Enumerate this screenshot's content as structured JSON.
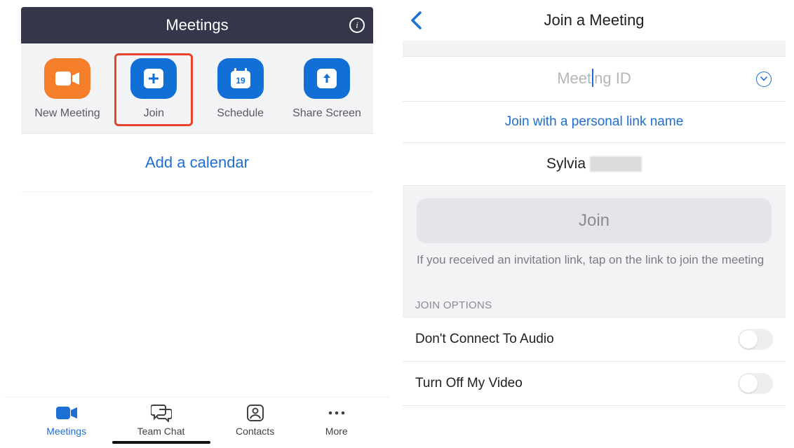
{
  "left": {
    "header_title": "Meetings",
    "actions": {
      "new_meeting": "New Meeting",
      "join": "Join",
      "schedule": "Schedule",
      "schedule_daynum": "19",
      "share_screen": "Share Screen"
    },
    "add_calendar": "Add a calendar",
    "tabs": {
      "meetings": "Meetings",
      "team_chat": "Team Chat",
      "contacts": "Contacts",
      "more": "More"
    }
  },
  "right": {
    "title": "Join a Meeting",
    "meeting_id_placeholder_left": "Meet",
    "meeting_id_placeholder_right": "ng ID",
    "personal_link": "Join with a personal link name",
    "user_name": "Sylvia",
    "join_button": "Join",
    "hint": "If you received an invitation link, tap on the link to join the meeting",
    "section_label": "JOIN OPTIONS",
    "opt_audio": "Don't Connect To Audio",
    "opt_video": "Turn Off My Video"
  }
}
